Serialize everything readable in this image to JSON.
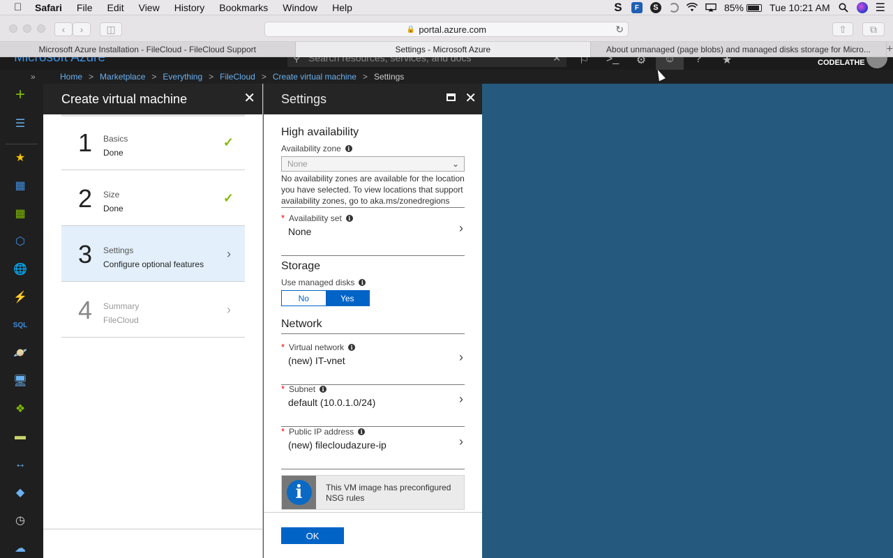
{
  "menubar": {
    "apple": "",
    "items": [
      "Safari",
      "File",
      "Edit",
      "View",
      "History",
      "Bookmarks",
      "Window",
      "Help"
    ],
    "battery": "85%",
    "clock": "Tue 10:21 AM"
  },
  "browser": {
    "url": "portal.azure.com",
    "tabs": [
      {
        "label": "Microsoft Azure Installation - FileCloud - FileCloud Support"
      },
      {
        "label": "Settings - Microsoft Azure"
      },
      {
        "label": "About unmanaged (page blobs) and managed disks storage for Micro..."
      }
    ],
    "add_tab": "+"
  },
  "azure_header": {
    "brand": "Microsoft Azure",
    "search_placeholder": "Search resources, services, and docs",
    "user": "CODELATHE"
  },
  "breadcrumb": {
    "items": [
      "Home",
      "Marketplace",
      "Everything",
      "FileCloud",
      "Create virtual machine"
    ],
    "current": "Settings",
    "separator": ">"
  },
  "create_vm": {
    "title": "Create virtual machine",
    "steps": [
      {
        "num": "1",
        "title": "Basics",
        "sub": "Done"
      },
      {
        "num": "2",
        "title": "Size",
        "sub": "Done"
      },
      {
        "num": "3",
        "title": "Settings",
        "sub": "Configure optional features"
      },
      {
        "num": "4",
        "title": "Summary",
        "sub": "FileCloud"
      }
    ]
  },
  "settings": {
    "title": "Settings",
    "high_availability": {
      "heading": "High availability",
      "zone_label": "Availability zone",
      "zone_value": "None",
      "zone_help": "No availability zones are available for the location you have selected. To view locations that support availability zones, go to aka.ms/zonedregions",
      "set_label": "Availability set",
      "set_value": "None"
    },
    "storage": {
      "heading": "Storage",
      "managed_label": "Use managed disks",
      "options": [
        "No",
        "Yes"
      ],
      "selected": "Yes"
    },
    "network": {
      "heading": "Network",
      "vnet_label": "Virtual network",
      "vnet_value": "(new) IT-vnet",
      "subnet_label": "Subnet",
      "subnet_value": "default (10.0.1.0/24)",
      "pip_label": "Public IP address",
      "pip_value": "(new) filecloudazure-ip"
    },
    "nsg_note": "This VM image has preconfigured NSG rules",
    "ok": "OK"
  },
  "colors": {
    "azure_blue": "#0063c6",
    "check_green": "#7fba00",
    "background": "#25597d"
  }
}
